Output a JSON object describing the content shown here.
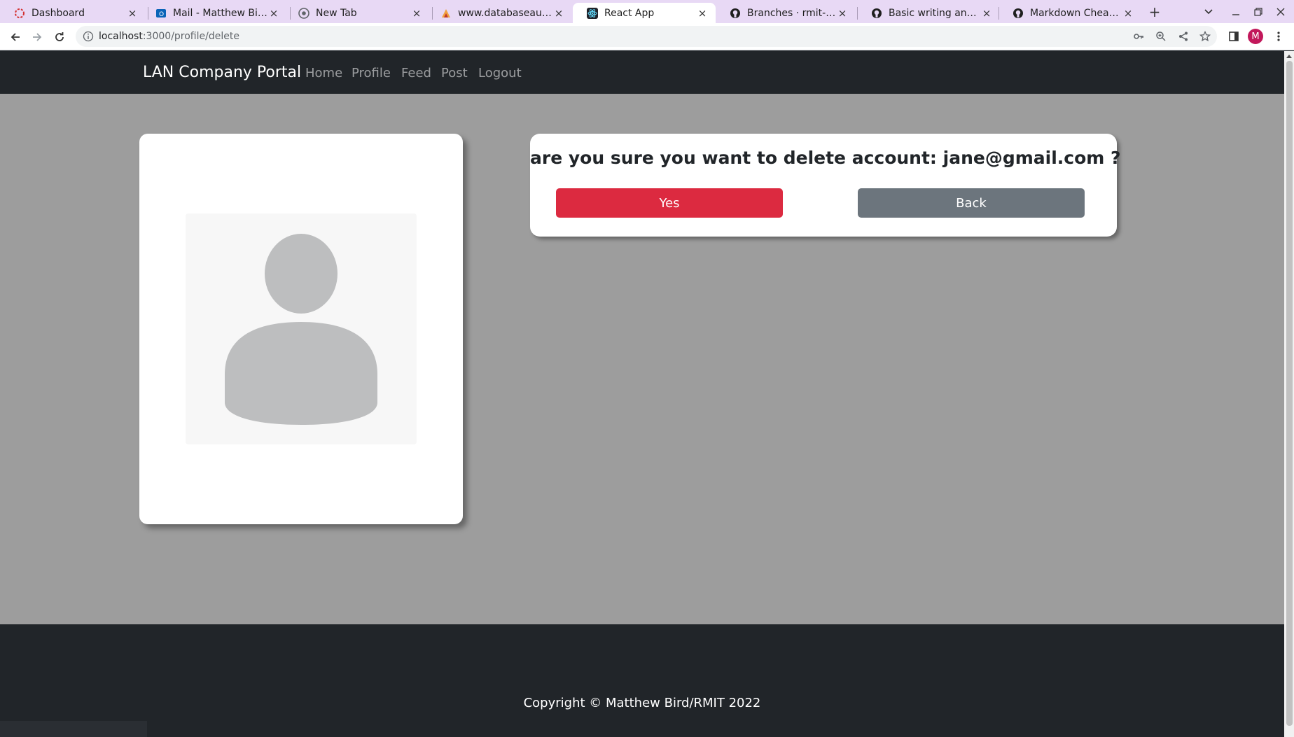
{
  "browser": {
    "tabs": [
      {
        "title": "Dashboard",
        "icon": "dashboard-favicon-icon",
        "active": false
      },
      {
        "title": "Mail - Matthew Bird - Outlook",
        "icon": "outlook-icon",
        "active": false
      },
      {
        "title": "New Tab",
        "icon": "chrome-icon",
        "active": false
      },
      {
        "title": "www.databaseaustralia.com",
        "icon": "database-site-icon",
        "active": false
      },
      {
        "title": "React App",
        "icon": "react-icon",
        "active": true
      },
      {
        "title": "Branches · rmit-fwp",
        "icon": "github-icon",
        "active": false
      },
      {
        "title": "Basic writing and formatting",
        "icon": "github-icon",
        "active": false
      },
      {
        "title": "Markdown Cheatsheet",
        "icon": "github-icon",
        "active": false
      }
    ],
    "url_host": "localhost",
    "url_rest": ":3000/profile/delete",
    "profile_initial": "M"
  },
  "navbar": {
    "brand": "LAN Company Portal",
    "links": [
      "Home",
      "Profile",
      "Feed",
      "Post",
      "Logout"
    ]
  },
  "confirm": {
    "question_prefix": "are you sure you want to delete account: ",
    "email": "jane@gmail.com",
    "question_suffix": " ?",
    "yes_label": "Yes",
    "back_label": "Back"
  },
  "footer": {
    "copyright": "Copyright © Matthew Bird/RMIT 2022"
  },
  "colors": {
    "navbar": "#212529",
    "page_bg": "#9d9d9d",
    "danger": "#dc2a40",
    "secondary": "#6c757d",
    "tabstrip": "#e8d9f5"
  }
}
